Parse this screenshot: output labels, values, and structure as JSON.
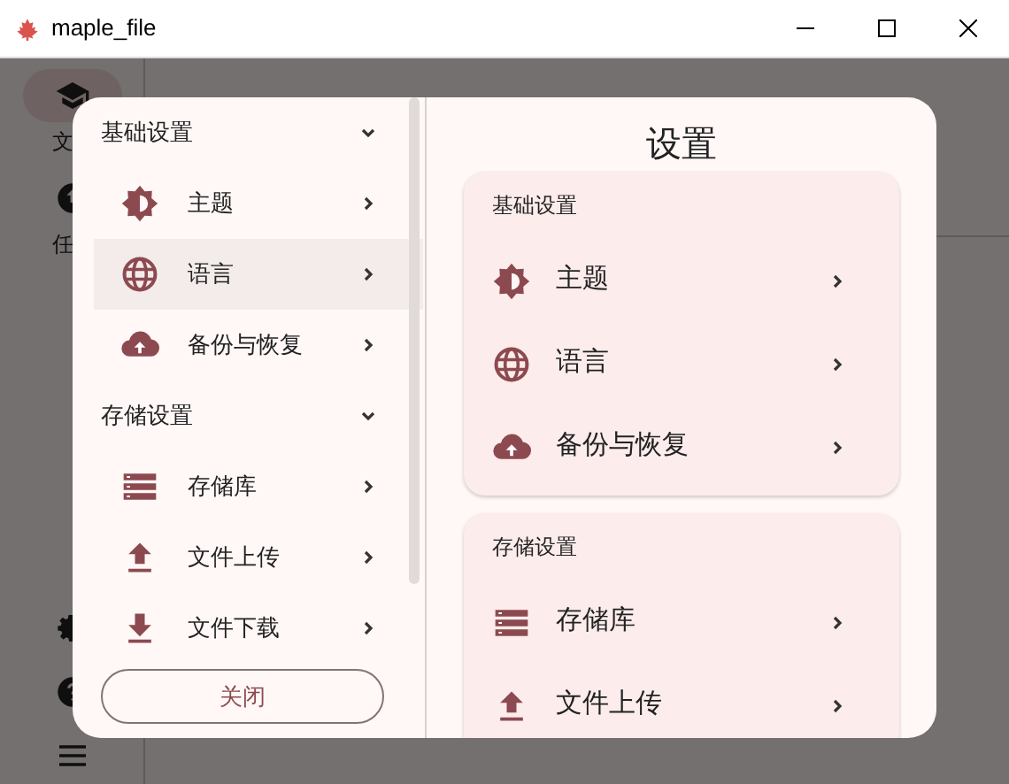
{
  "window": {
    "title": "maple_file"
  },
  "app_sidebar": {
    "items": [
      {
        "label": "文",
        "selected": true
      },
      {
        "label": "任",
        "selected": false
      }
    ]
  },
  "dialog": {
    "nav": [
      {
        "title": "基础设置",
        "expanded": true,
        "items": [
          {
            "label": "主题",
            "kind": "theme",
            "selected": false
          },
          {
            "label": "语言",
            "kind": "language",
            "selected": true
          },
          {
            "label": "备份与恢复",
            "kind": "backup",
            "selected": false
          }
        ]
      },
      {
        "title": "存储设置",
        "expanded": true,
        "items": [
          {
            "label": "存储库",
            "kind": "storage",
            "selected": false
          },
          {
            "label": "文件上传",
            "kind": "upload",
            "selected": false
          },
          {
            "label": "文件下载",
            "kind": "download",
            "selected": false
          }
        ]
      }
    ],
    "close_button": "关闭",
    "title": "设置",
    "cards": [
      {
        "title": "基础设置",
        "items": [
          {
            "label": "主题",
            "kind": "theme"
          },
          {
            "label": "语言",
            "kind": "language"
          },
          {
            "label": "备份与恢复",
            "kind": "backup"
          }
        ]
      },
      {
        "title": "存储设置",
        "items": [
          {
            "label": "存储库",
            "kind": "storage"
          },
          {
            "label": "文件上传",
            "kind": "upload"
          }
        ]
      }
    ]
  }
}
